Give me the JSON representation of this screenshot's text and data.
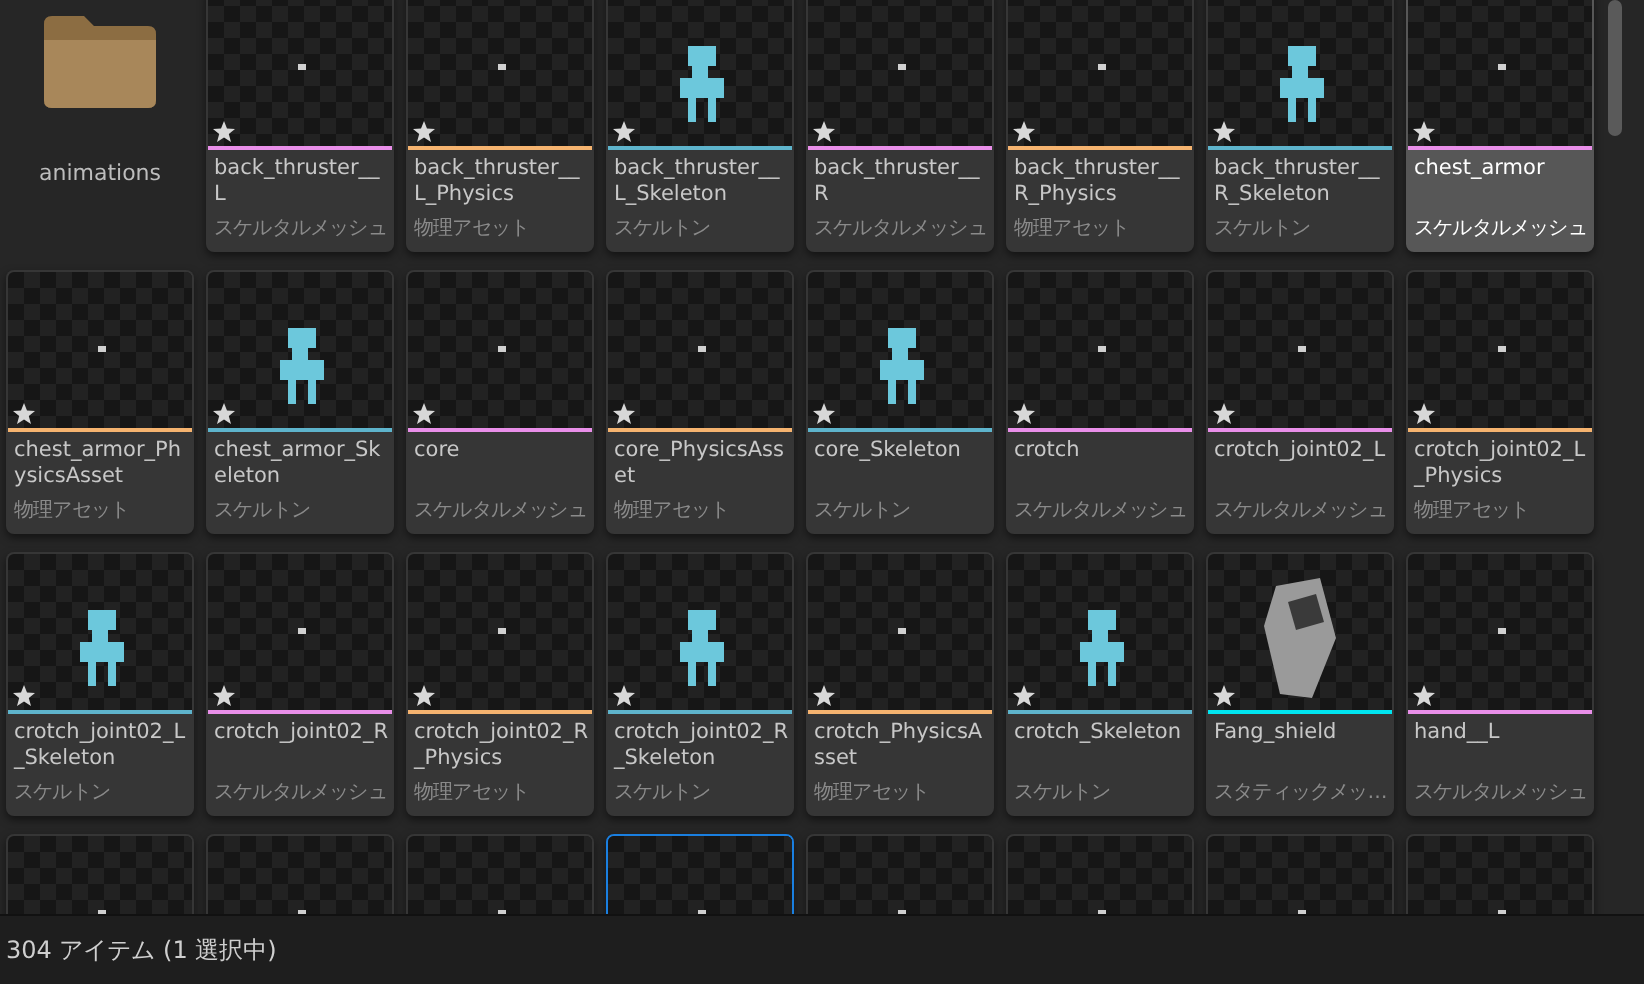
{
  "assets": [
    {
      "kind": "folder",
      "name": "animations"
    },
    {
      "kind": "asset",
      "name": "back_thruster__L",
      "type": "スケルタルメッシュ",
      "color": "#e98fe9",
      "thumbnail": {
        "kind": "speck"
      },
      "selected": false,
      "focused": false
    },
    {
      "kind": "asset",
      "name": "back_thruster__L_Physics",
      "type": "物理アセット",
      "color": "#f5b36f",
      "thumbnail": {
        "kind": "speck"
      },
      "selected": false,
      "focused": false
    },
    {
      "kind": "asset",
      "name": "back_thruster__L_Skeleton",
      "type": "スケルトン",
      "color": "#5eb4cc",
      "thumbnail": {
        "kind": "figure"
      },
      "selected": false,
      "focused": false
    },
    {
      "kind": "asset",
      "name": "back_thruster__R",
      "type": "スケルタルメッシュ",
      "color": "#e98fe9",
      "thumbnail": {
        "kind": "speck"
      },
      "selected": false,
      "focused": false
    },
    {
      "kind": "asset",
      "name": "back_thruster__R_Physics",
      "type": "物理アセット",
      "color": "#f5b36f",
      "thumbnail": {
        "kind": "speck"
      },
      "selected": false,
      "focused": false
    },
    {
      "kind": "asset",
      "name": "back_thruster__R_Skeleton",
      "type": "スケルトン",
      "color": "#5eb4cc",
      "thumbnail": {
        "kind": "figure"
      },
      "selected": false,
      "focused": false
    },
    {
      "kind": "asset",
      "name": "chest_armor",
      "type": "スケルタルメッシュ",
      "color": "#e98fe9",
      "thumbnail": {
        "kind": "speck"
      },
      "selected": true,
      "focused": false
    },
    {
      "kind": "asset",
      "name": "chest_armor_PhysicsAsset",
      "type": "物理アセット",
      "color": "#f5b36f",
      "thumbnail": {
        "kind": "speck"
      },
      "selected": false,
      "focused": false
    },
    {
      "kind": "asset",
      "name": "chest_armor_Skeleton",
      "type": "スケルトン",
      "color": "#5eb4cc",
      "thumbnail": {
        "kind": "figure"
      },
      "selected": false,
      "focused": false
    },
    {
      "kind": "asset",
      "name": "core",
      "type": "スケルタルメッシュ",
      "color": "#e98fe9",
      "thumbnail": {
        "kind": "speck"
      },
      "selected": false,
      "focused": false
    },
    {
      "kind": "asset",
      "name": "core_PhysicsAsset",
      "type": "物理アセット",
      "color": "#f5b36f",
      "thumbnail": {
        "kind": "speck"
      },
      "selected": false,
      "focused": false
    },
    {
      "kind": "asset",
      "name": "core_Skeleton",
      "type": "スケルトン",
      "color": "#5eb4cc",
      "thumbnail": {
        "kind": "figure"
      },
      "selected": false,
      "focused": false
    },
    {
      "kind": "asset",
      "name": "crotch",
      "type": "スケルタルメッシュ",
      "color": "#e98fe9",
      "thumbnail": {
        "kind": "speck"
      },
      "selected": false,
      "focused": false
    },
    {
      "kind": "asset",
      "name": "crotch_joint02_L",
      "type": "スケルタルメッシュ",
      "color": "#e98fe9",
      "thumbnail": {
        "kind": "speck"
      },
      "selected": false,
      "focused": false
    },
    {
      "kind": "asset",
      "name": "crotch_joint02_L_Physics",
      "type": "物理アセット",
      "color": "#f5b36f",
      "thumbnail": {
        "kind": "speck"
      },
      "selected": false,
      "focused": false
    },
    {
      "kind": "asset",
      "name": "crotch_joint02_L_Skeleton",
      "type": "スケルトン",
      "color": "#5eb4cc",
      "thumbnail": {
        "kind": "figure"
      },
      "selected": false,
      "focused": false
    },
    {
      "kind": "asset",
      "name": "crotch_joint02_R",
      "type": "スケルタルメッシュ",
      "color": "#e98fe9",
      "thumbnail": {
        "kind": "speck"
      },
      "selected": false,
      "focused": false
    },
    {
      "kind": "asset",
      "name": "crotch_joint02_R_Physics",
      "type": "物理アセット",
      "color": "#f5b36f",
      "thumbnail": {
        "kind": "speck"
      },
      "selected": false,
      "focused": false
    },
    {
      "kind": "asset",
      "name": "crotch_joint02_R_Skeleton",
      "type": "スケルトン",
      "color": "#5eb4cc",
      "thumbnail": {
        "kind": "figure"
      },
      "selected": false,
      "focused": false
    },
    {
      "kind": "asset",
      "name": "crotch_PhysicsAsset",
      "type": "物理アセット",
      "color": "#f5b36f",
      "thumbnail": {
        "kind": "speck"
      },
      "selected": false,
      "focused": false
    },
    {
      "kind": "asset",
      "name": "crotch_Skeleton",
      "type": "スケルトン",
      "color": "#5eb4cc",
      "thumbnail": {
        "kind": "figure"
      },
      "selected": false,
      "focused": false
    },
    {
      "kind": "asset",
      "name": "Fang_shield",
      "type": "スタティックメッ…",
      "color": "#00e5f0",
      "thumbnail": {
        "kind": "shield"
      },
      "selected": false,
      "focused": false
    },
    {
      "kind": "asset",
      "name": "hand__L",
      "type": "スケルタルメッシュ",
      "color": "#e98fe9",
      "thumbnail": {
        "kind": "speck"
      },
      "selected": false,
      "focused": false
    },
    {
      "kind": "partial",
      "thumbnail": {
        "kind": "speck"
      },
      "focused": false
    },
    {
      "kind": "partial",
      "thumbnail": {
        "kind": "speck"
      },
      "focused": false
    },
    {
      "kind": "partial",
      "thumbnail": {
        "kind": "speck"
      },
      "focused": false
    },
    {
      "kind": "partial",
      "thumbnail": {
        "kind": "speck"
      },
      "focused": true
    },
    {
      "kind": "partial",
      "thumbnail": {
        "kind": "speck"
      },
      "focused": false
    },
    {
      "kind": "partial",
      "thumbnail": {
        "kind": "speck"
      },
      "focused": false
    },
    {
      "kind": "partial",
      "thumbnail": {
        "kind": "speck"
      },
      "focused": false
    },
    {
      "kind": "partial",
      "thumbnail": {
        "kind": "speck"
      },
      "focused": false
    }
  ],
  "status_bar": {
    "text": "304 アイテム (1 選択中)"
  }
}
